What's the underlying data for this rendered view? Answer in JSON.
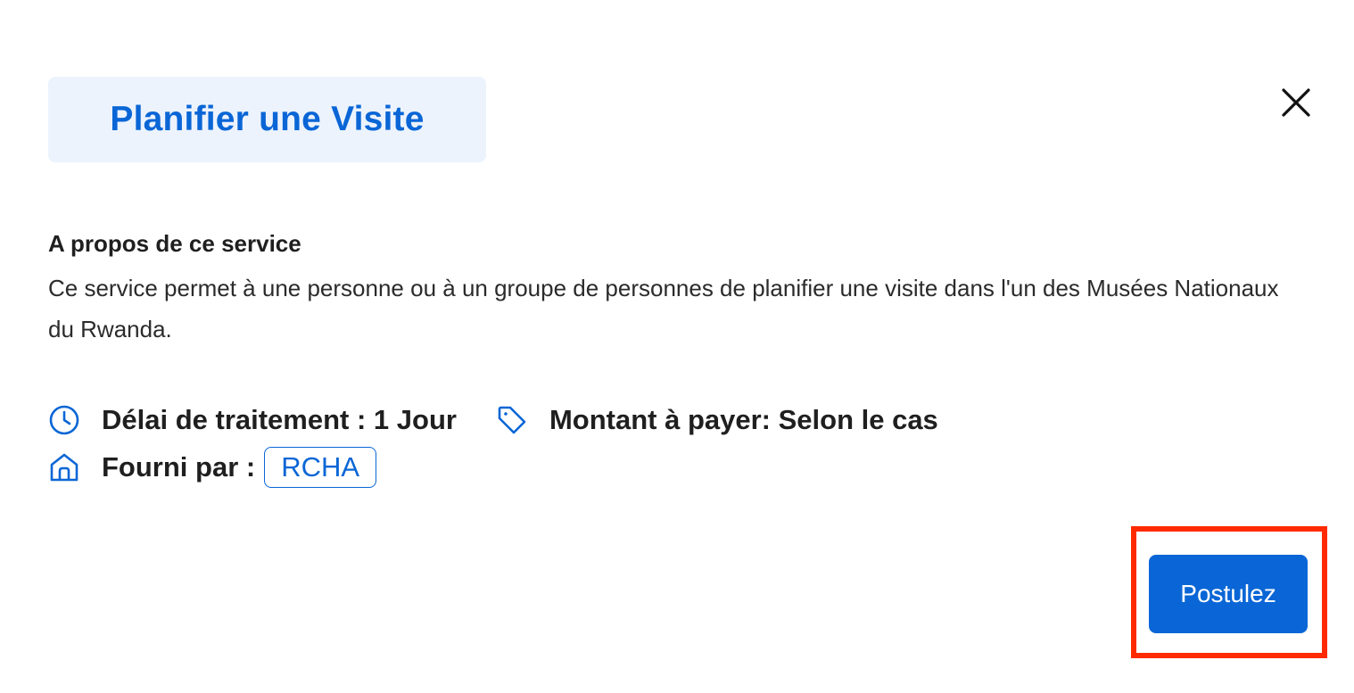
{
  "header": {
    "title": "Planifier une Visite",
    "close_icon": "close-icon"
  },
  "about": {
    "heading": "A propos de ce service",
    "description": "Ce service permet à une personne ou à un groupe de personnes de planifier une visite dans l'un des Musées Nationaux du Rwanda."
  },
  "meta": {
    "processing_icon": "clock-icon",
    "processing_label": "Délai de traitement : 1 Jour",
    "fee_icon": "tag-icon",
    "fee_label": "Montant à payer: Selon le cas",
    "provider_icon": "home-icon",
    "provider_label": "Fourni par :",
    "provider_value": "RCHA"
  },
  "actions": {
    "apply_label": "Postulez"
  },
  "colors": {
    "accent": "#0a66d6",
    "title_bg": "#ecf3fd",
    "highlight": "#ff2a00"
  }
}
